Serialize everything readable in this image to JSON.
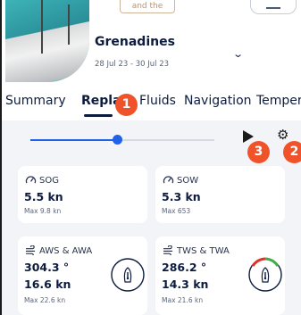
{
  "header": {
    "anchor_tag": "and the",
    "boat_name": "Grenadines",
    "dates": "28 Jul 23 - 30 Jul 23",
    "chevron": "⌄"
  },
  "tabs": [
    {
      "label": "Summary"
    },
    {
      "label": "Replay"
    },
    {
      "label": "Fluids"
    },
    {
      "label": "Navigation"
    },
    {
      "label": "Tempera"
    }
  ],
  "badges": [
    "1",
    "2",
    "3"
  ],
  "slider": {
    "progress": 0.47
  },
  "controls": {
    "play": "▶",
    "settings": "⚙"
  },
  "cards": [
    {
      "label": "SOG",
      "value": "5.5 kn",
      "max": "Max 9.8 kn",
      "icon": "gauge-icon"
    },
    {
      "label": "SOW",
      "value": "5.3 kn",
      "max": "Max 653",
      "icon": "gauge-icon"
    },
    {
      "label": "AWS & AWA",
      "value": "304.3 °",
      "value2": "16.6 kn",
      "max": "Max 22.6 kn",
      "icon": "wind-icon"
    },
    {
      "label": "TWS & TWA",
      "value": "286.2 °",
      "value2": "14.3 kn",
      "max": "Max 21.6 kn",
      "icon": "wind-icon"
    }
  ],
  "colors": {
    "accent": "#1f62e8",
    "badge": "#f0532a",
    "navy": "#0d1b3e"
  }
}
